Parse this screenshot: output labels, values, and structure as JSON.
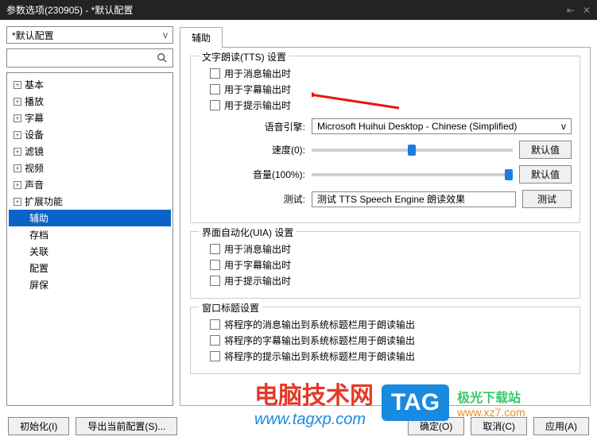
{
  "window": {
    "title": "参数选项(230905) - *默认配置"
  },
  "sidebar": {
    "profile": "*默认配置",
    "tree": [
      {
        "label": "基本",
        "exp": true
      },
      {
        "label": "播放",
        "exp": true
      },
      {
        "label": "字幕",
        "exp": true
      },
      {
        "label": "设备",
        "exp": true
      },
      {
        "label": "滤镜",
        "exp": false
      },
      {
        "label": "视频",
        "exp": true
      },
      {
        "label": "声音",
        "exp": true
      },
      {
        "label": "扩展功能",
        "exp": true
      },
      {
        "label": "辅助",
        "selected": true,
        "indent": true
      },
      {
        "label": "存档",
        "indent": true
      },
      {
        "label": "关联",
        "indent": true
      },
      {
        "label": "配置",
        "indent": true
      },
      {
        "label": "屏保",
        "indent": true
      }
    ]
  },
  "tab": "辅助",
  "groups": {
    "tts": {
      "title": "文字朗读(TTS) 设置",
      "checks": [
        "用于消息输出时",
        "用于字幕输出时",
        "用于提示输出时"
      ],
      "engine_label": "语音引擎",
      "engine_value": "Microsoft Huihui Desktop - Chinese (Simplified)",
      "speed_label": "速度(0)",
      "volume_label": "音量(100%)",
      "default_btn": "默认值",
      "test_label": "测试",
      "test_value": "测试 TTS Speech Engine 朗读效果",
      "test_btn": "测试"
    },
    "uia": {
      "title": "界面自动化(UIA) 设置",
      "checks": [
        "用于消息输出时",
        "用于字幕输出时",
        "用于提示输出时"
      ]
    },
    "title_group": {
      "title": "窗口标题设置",
      "checks": [
        "将程序的消息输出到系统标题栏用于朗读输出",
        "将程序的字幕输出到系统标题栏用于朗读输出",
        "将程序的提示输出到系统标题栏用于朗读输出"
      ]
    }
  },
  "buttons": {
    "init": "初始化(I)",
    "export": "导出当前配置(S)...",
    "ok": "确定(O)",
    "cancel": "取消(C)",
    "apply": "应用(A)"
  },
  "overlay": {
    "brand_cn": "电脑技术网",
    "brand_url": "www.tagxp.com",
    "tag": "TAG",
    "brand2_cn": "极光下载站",
    "brand2_url": "www.xz7.com"
  }
}
